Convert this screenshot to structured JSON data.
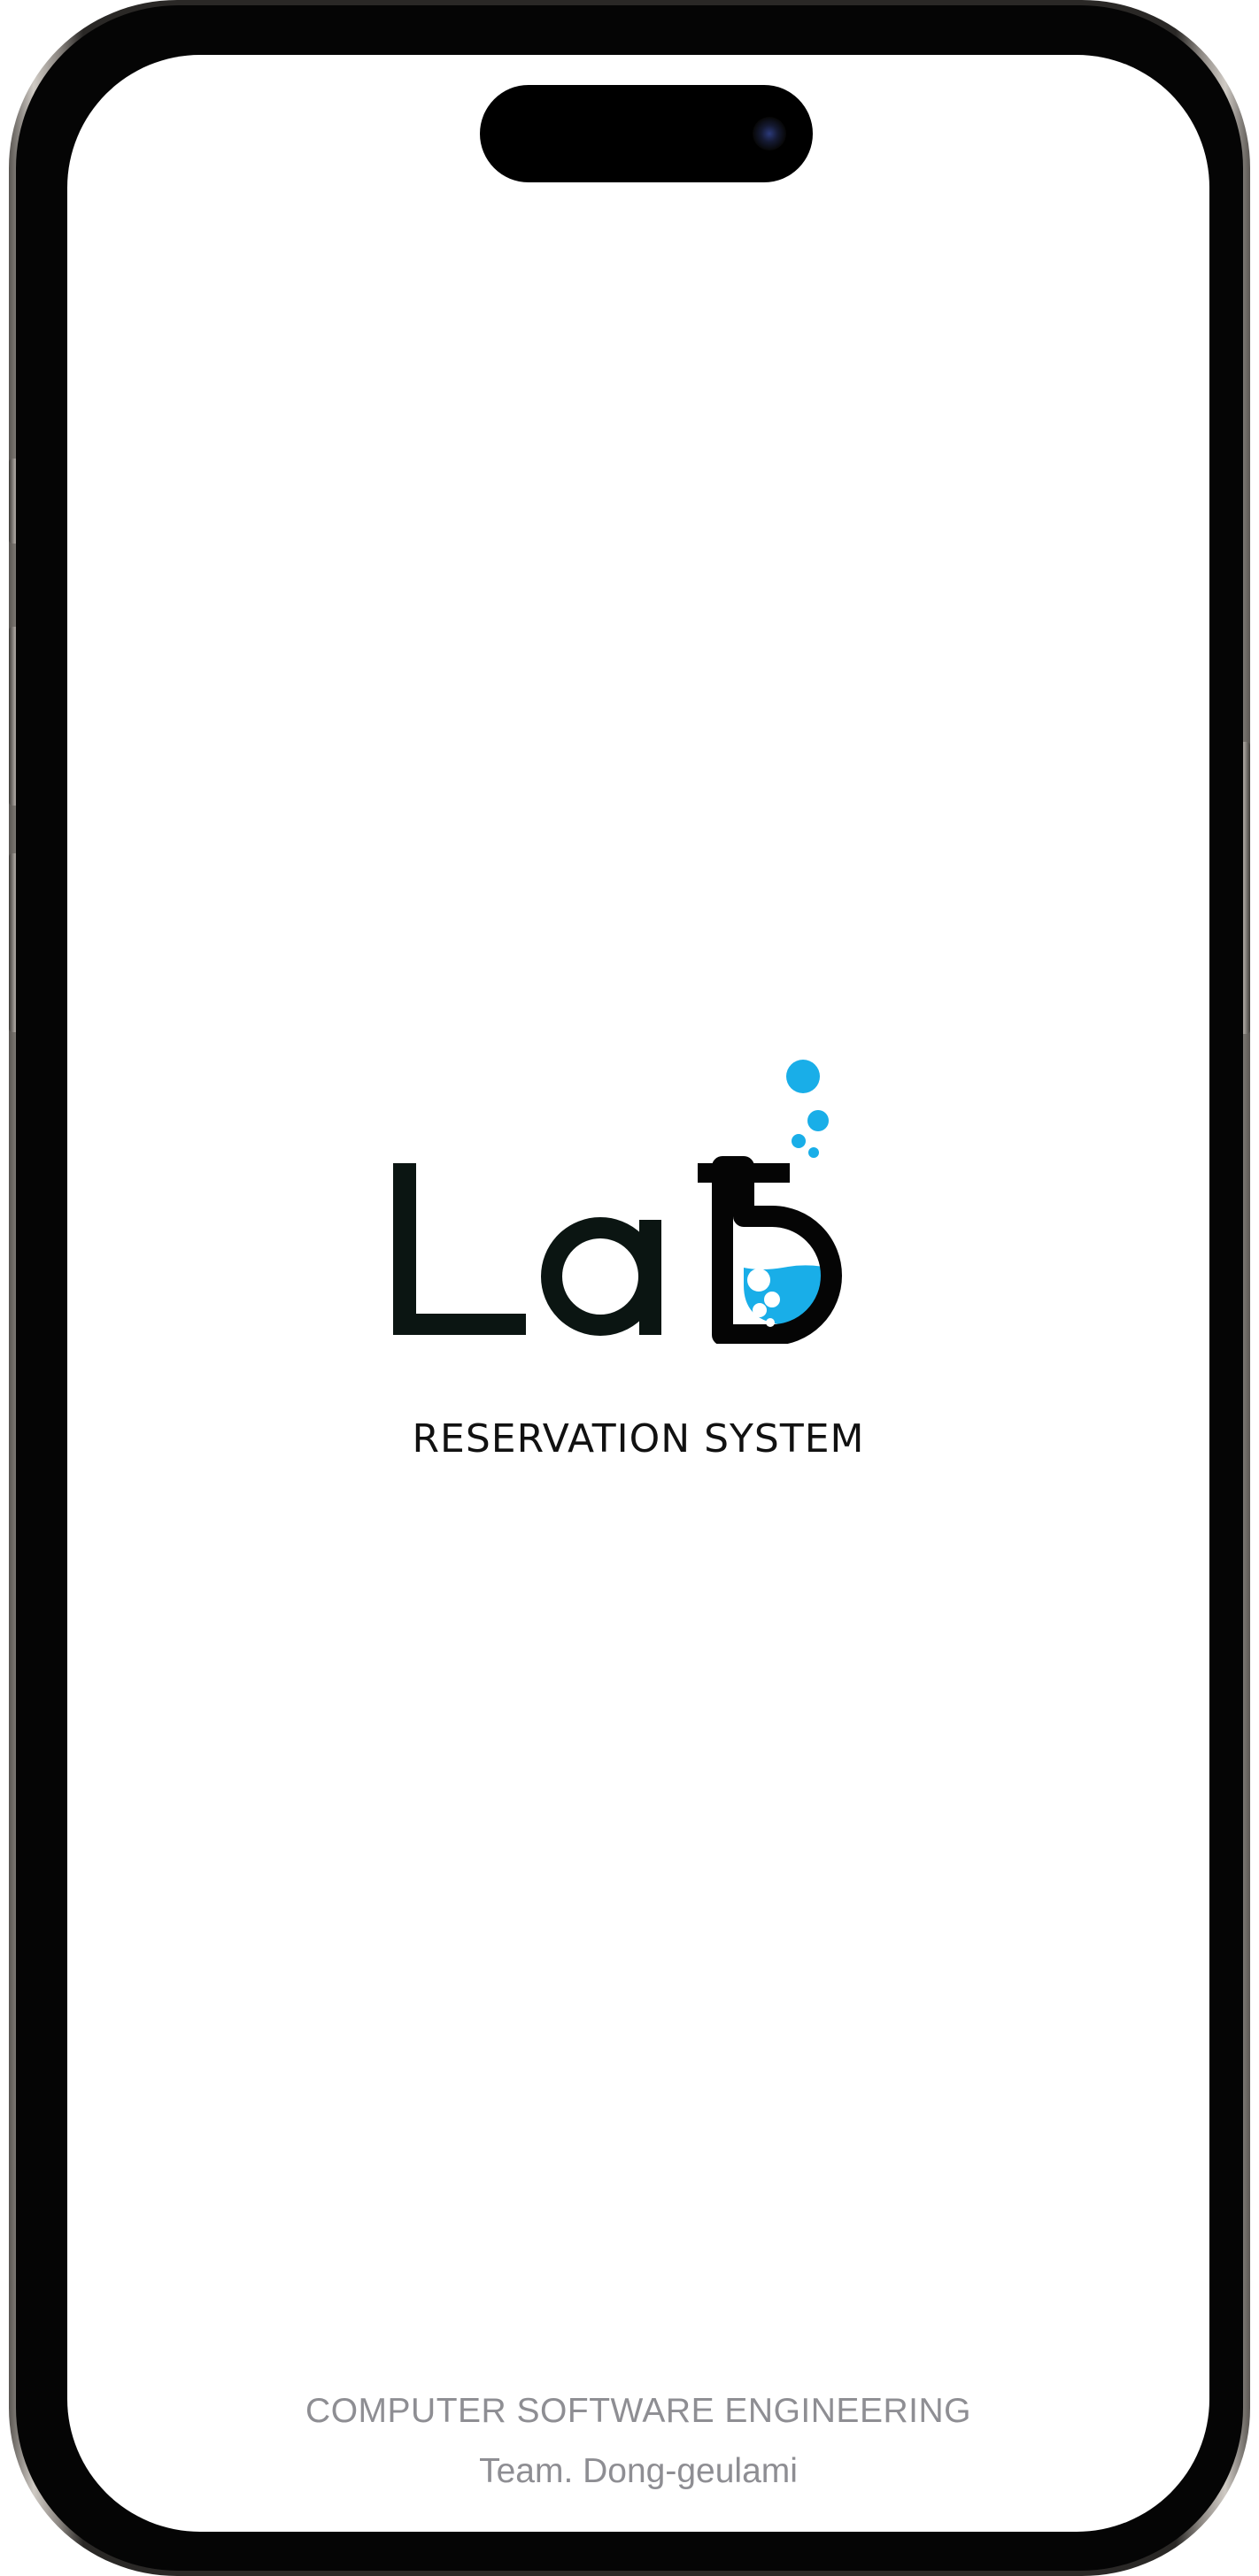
{
  "splash": {
    "logo_text": "Lab",
    "subtitle": "RESERVATION SYSTEM",
    "footer_line1": "COMPUTER SOFTWARE ENGINEERING",
    "footer_line2": "Team. Dong-geulami"
  },
  "colors": {
    "background": "#ffffff",
    "logo_dark": "#0b1512",
    "logo_accent": "#19aee8",
    "footer_text": "#8e8e93"
  },
  "icons": {
    "logo": "lab-flask-logo",
    "camera": "front-camera-icon"
  }
}
